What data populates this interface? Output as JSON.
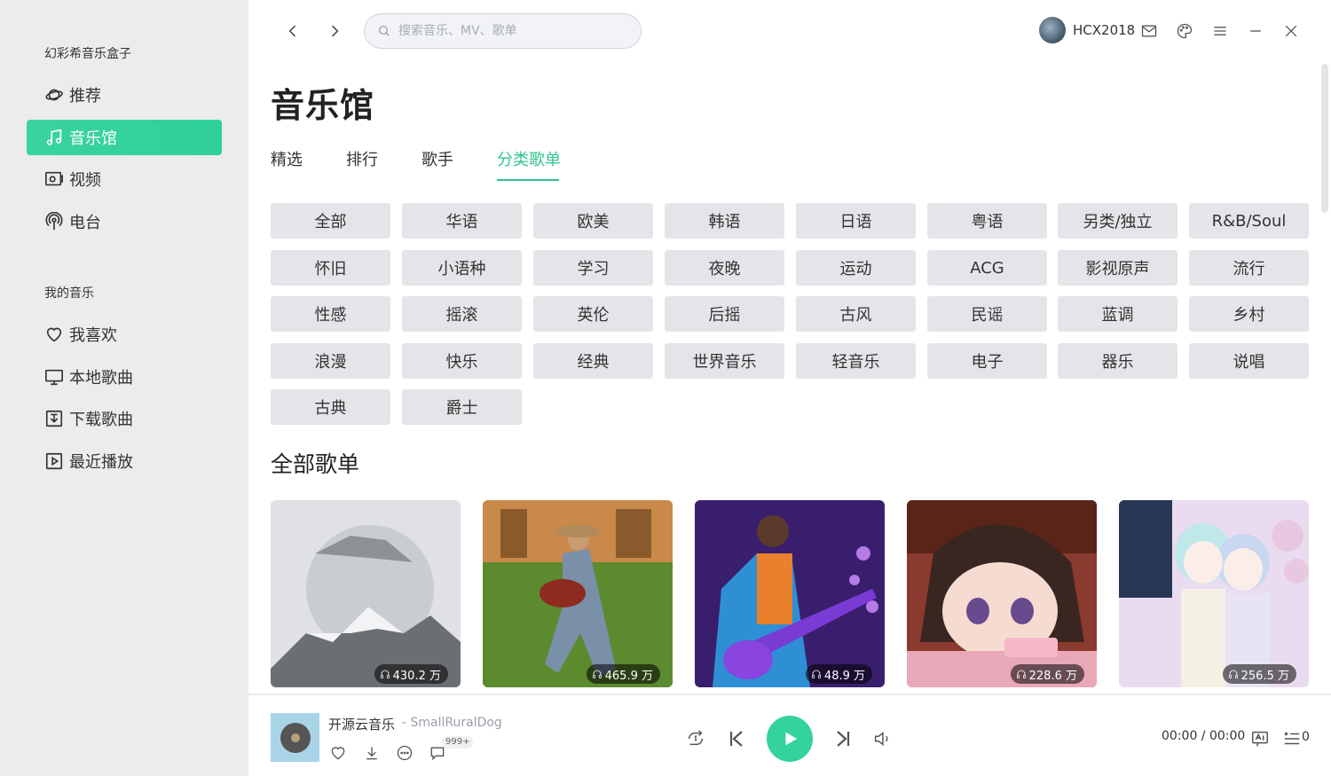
{
  "sidebar": {
    "app_title": "幻彩希音乐盒子",
    "items": [
      {
        "label": "推荐",
        "icon": "planet-icon",
        "active": false
      },
      {
        "label": "音乐馆",
        "icon": "music-note-icon",
        "active": true
      },
      {
        "label": "视频",
        "icon": "video-icon",
        "active": false
      },
      {
        "label": "电台",
        "icon": "radio-icon",
        "active": false
      }
    ],
    "my_music_title": "我的音乐",
    "my_items": [
      {
        "label": "我喜欢",
        "icon": "heart-icon"
      },
      {
        "label": "本地歌曲",
        "icon": "monitor-icon"
      },
      {
        "label": "下载歌曲",
        "icon": "download-icon"
      },
      {
        "label": "最近播放",
        "icon": "play-square-icon"
      }
    ]
  },
  "header": {
    "search_placeholder": "搜索音乐、MV、歌单",
    "username": "HCX2018"
  },
  "main": {
    "title": "音乐馆",
    "tabs": [
      "精选",
      "排行",
      "歌手",
      "分类歌单"
    ],
    "active_tab": "分类歌单",
    "categories": [
      "全部",
      "华语",
      "欧美",
      "韩语",
      "日语",
      "粤语",
      "另类/独立",
      "R&B/Soul",
      "怀旧",
      "小语种",
      "学习",
      "夜晚",
      "运动",
      "ACG",
      "影视原声",
      "流行",
      "性感",
      "摇滚",
      "英伦",
      "后摇",
      "古风",
      "民谣",
      "蓝调",
      "乡村",
      "浪漫",
      "快乐",
      "经典",
      "世界音乐",
      "轻音乐",
      "电子",
      "器乐",
      "说唱",
      "古典",
      "爵士"
    ],
    "section_title": "全部歌单",
    "playlists": [
      {
        "plays": "430.2 万"
      },
      {
        "plays": "465.9 万"
      },
      {
        "plays": "48.9 万"
      },
      {
        "plays": "228.6 万"
      },
      {
        "plays": "256.5 万"
      }
    ]
  },
  "player": {
    "song": "开源云音乐",
    "artist": "- SmallRuralDog",
    "comment_badge": "999+",
    "time": "00:00 / 00:00",
    "queue_count": "0"
  },
  "colors": {
    "accent": "#33d29e",
    "sidebar_bg": "#ececee",
    "chip_bg": "#e4e5e8"
  }
}
